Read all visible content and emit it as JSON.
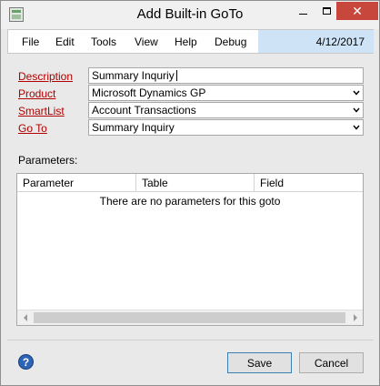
{
  "window": {
    "title": "Add Built-in GoTo",
    "close_glyph": "✕"
  },
  "menu": {
    "items": [
      "File",
      "Edit",
      "Tools",
      "View",
      "Help",
      "Debug"
    ],
    "date": "4/12/2017"
  },
  "form": {
    "description": {
      "label": "Description",
      "value": "Summary Inquriy"
    },
    "product": {
      "label": "Product",
      "value": "Microsoft Dynamics GP"
    },
    "smartlist": {
      "label": "SmartList",
      "value": "Account Transactions"
    },
    "goto": {
      "label": "Go To",
      "value": "Summary Inquiry"
    }
  },
  "parameters": {
    "label": "Parameters:",
    "columns": [
      "Parameter",
      "Table",
      "Field"
    ],
    "empty_message": "There are no parameters for this goto"
  },
  "footer": {
    "help_glyph": "?",
    "save_label": "Save",
    "cancel_label": "Cancel"
  },
  "icons": {
    "app": "app-window-icon",
    "help": "help-icon",
    "dropdown": "chevron-down-icon",
    "scroll_left": "arrow-left-icon",
    "scroll_right": "arrow-right-icon"
  }
}
